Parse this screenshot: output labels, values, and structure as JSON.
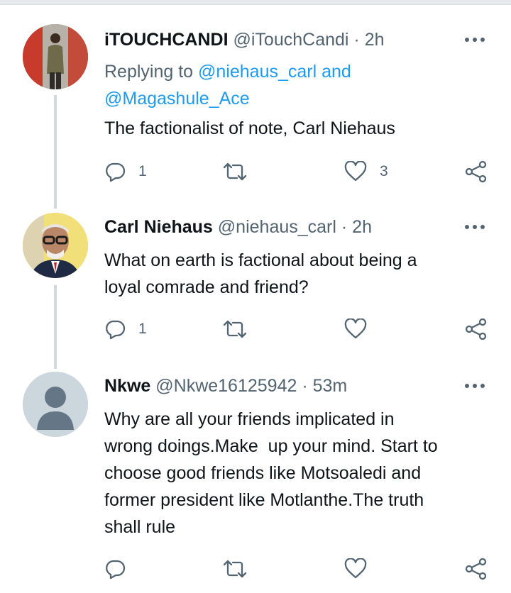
{
  "tweets": [
    {
      "name": "iTOUCHCANDI",
      "handle": "@iTouchCandi",
      "separator": "·",
      "time": "2h",
      "reply_prefix": "Replying to",
      "reply_user1": "@niehaus_carl",
      "reply_and": "and",
      "reply_user2": "@Magashule_Ace",
      "text": "The factionalist of note, Carl Niehaus",
      "replies": "1",
      "likes": "3"
    },
    {
      "name": "Carl Niehaus",
      "handle": "@niehaus_carl",
      "separator": "·",
      "time": "2h",
      "text_line1": "What on earth is factional about being a",
      "text_line2": "loyal comrade and friend?",
      "replies": "1"
    },
    {
      "name": "Nkwe",
      "handle": "@Nkwe16125942",
      "separator": "·",
      "time": "53m",
      "text_lines": [
        "Why are all your friends implicated in",
        "wrong doings.Make  up your mind. Start to",
        "choose good friends like Motsoaledi and",
        "former president like Motlanthe.The truth",
        "shall rule"
      ]
    }
  ],
  "colors": {
    "text": "#0f1419",
    "secondary": "#536471",
    "link": "#1d9bf0",
    "thread_line": "#cfd9de"
  },
  "icons": [
    "more-icon",
    "reply-icon",
    "retweet-icon",
    "like-icon",
    "share-icon",
    "default-avatar-icon"
  ]
}
